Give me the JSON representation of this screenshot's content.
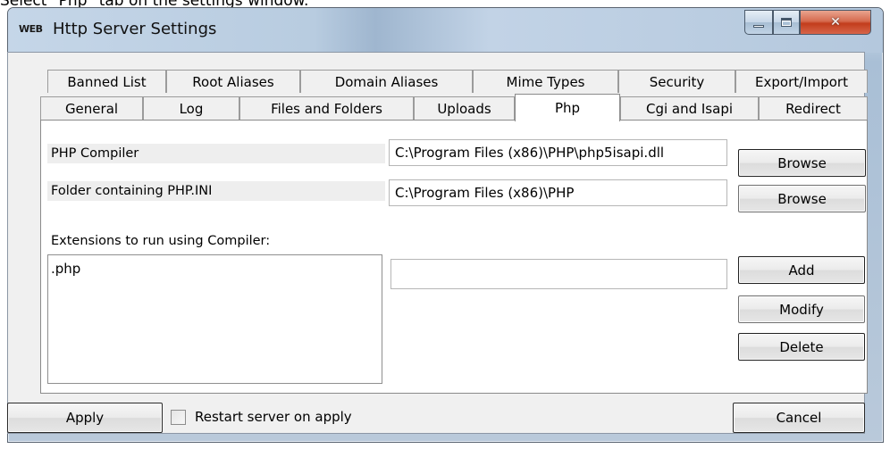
{
  "caption": "Select \"Php\" tab on the settings window.",
  "window": {
    "icon_text": "WEB",
    "title": "Http Server Settings"
  },
  "tabs_row1": [
    "Banned List",
    "Root Aliases",
    "Domain Aliases",
    "Mime Types",
    "Security",
    "Export/Import"
  ],
  "tabs_row2": [
    "General",
    "Log",
    "Files and Folders",
    "Uploads",
    "Php",
    "Cgi and Isapi",
    "Redirect"
  ],
  "active_tab": "Php",
  "php": {
    "compiler_label": "PHP Compiler",
    "compiler_value": "C:\\Program Files (x86)\\PHP\\php5isapi.dll",
    "ini_label": "Folder containing PHP.INI",
    "ini_value": "C:\\Program Files (x86)\\PHP",
    "browse_label": "Browse",
    "extensions_label": "Extensions to run using Compiler:",
    "extensions": [
      ".php"
    ],
    "extension_input_value": "",
    "add_label": "Add",
    "modify_label": "Modify",
    "delete_label": "Delete"
  },
  "footer": {
    "apply_label": "Apply",
    "restart_label": "Restart server on apply",
    "restart_checked": false,
    "cancel_label": "Cancel"
  }
}
